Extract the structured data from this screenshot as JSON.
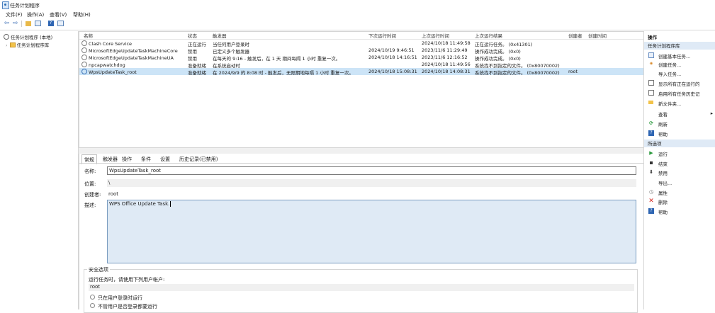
{
  "window": {
    "title": "任务计划程序"
  },
  "menu": [
    "文件(F)",
    "操作(A)",
    "查看(V)",
    "帮助(H)"
  ],
  "tree": {
    "root": "任务计划程序 (本地)",
    "library": "任务计划程序库"
  },
  "list": {
    "columns": [
      "名称",
      "状态",
      "触发器",
      "下次运行时间",
      "上次运行时间",
      "上次运行结果",
      "创建者",
      "创建时间"
    ],
    "rows": [
      {
        "name": "Clash Core Service",
        "status": "正在运行",
        "trigger": "当任何用户登录时",
        "next": "",
        "last": "2024/10/18 11:49:58",
        "result": "正在运行任务。 (0x41301)",
        "author": "",
        "created": ""
      },
      {
        "name": "MicrosoftEdgeUpdateTaskMachineCore",
        "status": "禁用",
        "trigger": "已定义多个触发器",
        "next": "2024/10/19 9:46:51",
        "last": "2023/11/6 11:29:49",
        "result": "操作成功完成。 (0x0)",
        "author": "",
        "created": ""
      },
      {
        "name": "MicrosoftEdgeUpdateTaskMachineUA",
        "status": "禁用",
        "trigger": "在每天的 9:16 - 触发后，在 1 天 期间每隔 1 小时 重复一次。",
        "next": "2024/10/18 14:16:51",
        "last": "2023/11/6 12:16:52",
        "result": "操作成功完成。 (0x0)",
        "author": "",
        "created": ""
      },
      {
        "name": "npcapwatchdog",
        "status": "准备就绪",
        "trigger": "在系统启动时",
        "next": "",
        "last": "2024/10/18 11:49:56",
        "result": "系统找不到指定的文件。 (0x80070002)",
        "author": "",
        "created": ""
      },
      {
        "name": "WpsUpdateTask_root",
        "status": "准备就绪",
        "trigger": "在 2024/9/9 的 8:08 时 - 触发后，无限期地每隔 1 小时 重复一次。",
        "next": "2024/10/18 15:08:31",
        "last": "2024/10/18 14:08:31",
        "result": "系统找不到指定的文件。 (0x80070002)",
        "author": "root",
        "created": ""
      }
    ],
    "selected_index": 4
  },
  "detail": {
    "tabs": [
      "常规",
      "触发器",
      "操作",
      "条件",
      "设置",
      "历史记录(已禁用)"
    ],
    "name_label": "名称:",
    "name_value": "WpsUpdateTask_root",
    "location_label": "位置:",
    "location_value": "\\",
    "author_label": "创建者:",
    "author_value": "root",
    "desc_label": "描述:",
    "desc_value": "WPS Office Update Task.",
    "security_title": "安全选项",
    "run_as_label": "运行任务时，请使用下列用户帐户:",
    "run_as_value": "root",
    "radio1": "只在用户登录时运行",
    "radio2": "不管用户是否登录都要运行"
  },
  "actions": {
    "header": "操作",
    "section1": "任务计划程序库",
    "items1": [
      {
        "icon": "create-basic-task-icon",
        "label": "创建基本任务..."
      },
      {
        "icon": "create-task-icon",
        "label": "创建任务..."
      },
      {
        "icon": "",
        "label": "导入任务..."
      },
      {
        "icon": "display-running-icon",
        "label": "显示所有正在运行的"
      },
      {
        "icon": "enable-history-icon",
        "label": "启用所有任务历史记"
      },
      {
        "icon": "new-folder-icon",
        "label": "新文件夹..."
      },
      {
        "icon": "",
        "label": "查看"
      },
      {
        "icon": "refresh-icon",
        "label": "刷新"
      },
      {
        "icon": "help-icon",
        "label": "帮助"
      }
    ],
    "section2": "所选项",
    "items2": [
      {
        "icon": "run-icon",
        "label": "运行"
      },
      {
        "icon": "end-icon",
        "label": "结束"
      },
      {
        "icon": "disable-icon",
        "label": "禁用"
      },
      {
        "icon": "",
        "label": "导出..."
      },
      {
        "icon": "properties-icon",
        "label": "属性"
      },
      {
        "icon": "delete-icon",
        "label": "删除"
      },
      {
        "icon": "help-icon",
        "label": "帮助"
      }
    ]
  }
}
